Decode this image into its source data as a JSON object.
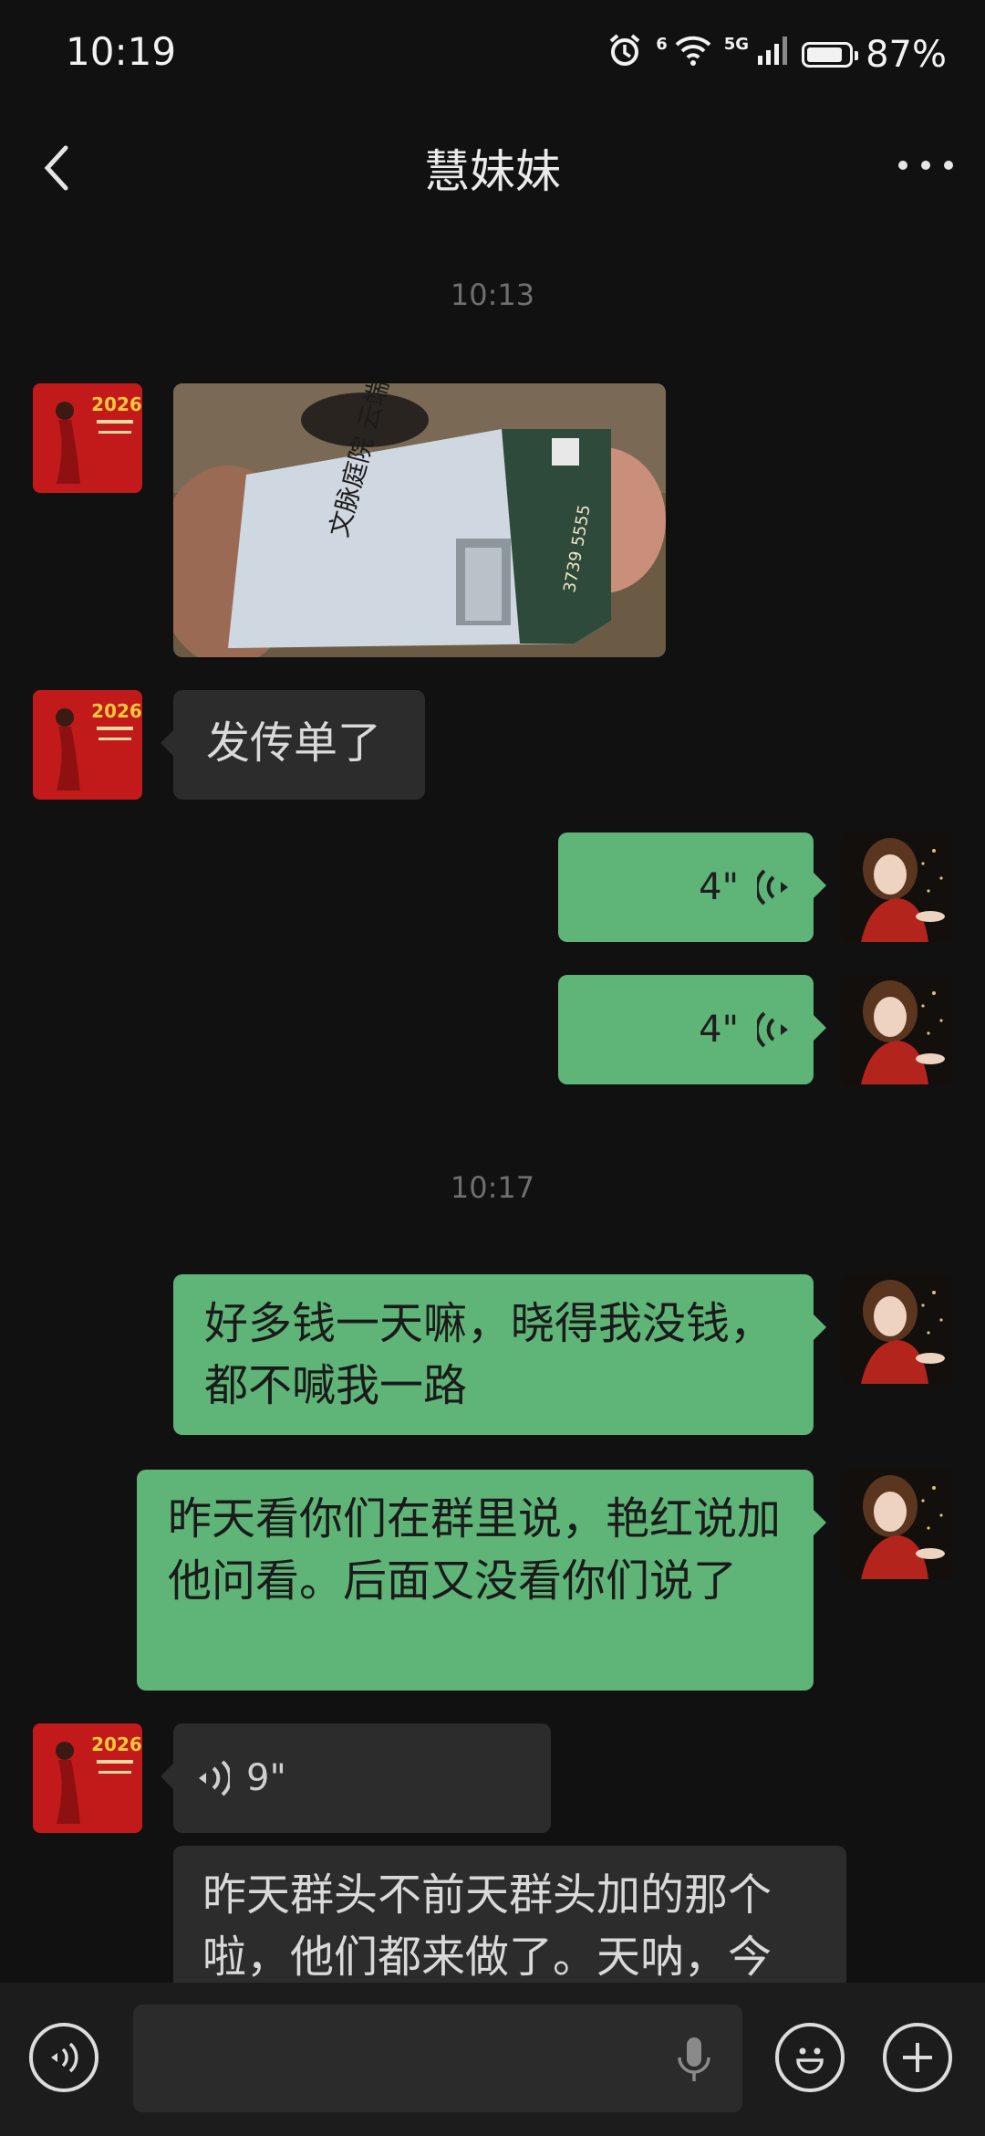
{
  "status_bar": {
    "time": "10:19",
    "signal_1": "6",
    "signal_2": "5G",
    "battery_level": 0.87,
    "battery_text": "87%"
  },
  "header": {
    "title": "慧妹妹"
  },
  "messages": {
    "ts1": "10:13",
    "text_in_1": "发传单了",
    "voice_out_1": "4\"",
    "voice_out_2": "4\"",
    "ts2": "10:17",
    "text_out_1": "好多钱一天嘛，晓得我没钱，都不喊我一路",
    "text_out_2": "昨天看你们在群里说，艳红说加他问看。后面又没看你们说了",
    "voice_in_1": "9\"",
    "text_in_2": "昨天群头不前天群头加的那个啦，他们都来做了。天呐，今"
  },
  "photo": {
    "flyer_title": "文脉庭院 云端高居",
    "flyer_phone": "3739 5555"
  },
  "avatar_text": {
    "year": "2026"
  },
  "input": {
    "value": ""
  },
  "colors": {
    "background": "#111111",
    "outgoing_bubble": "#5fb477",
    "incoming_bubble": "#2c2c2c",
    "bottom_bar": "#1c1c1c"
  }
}
